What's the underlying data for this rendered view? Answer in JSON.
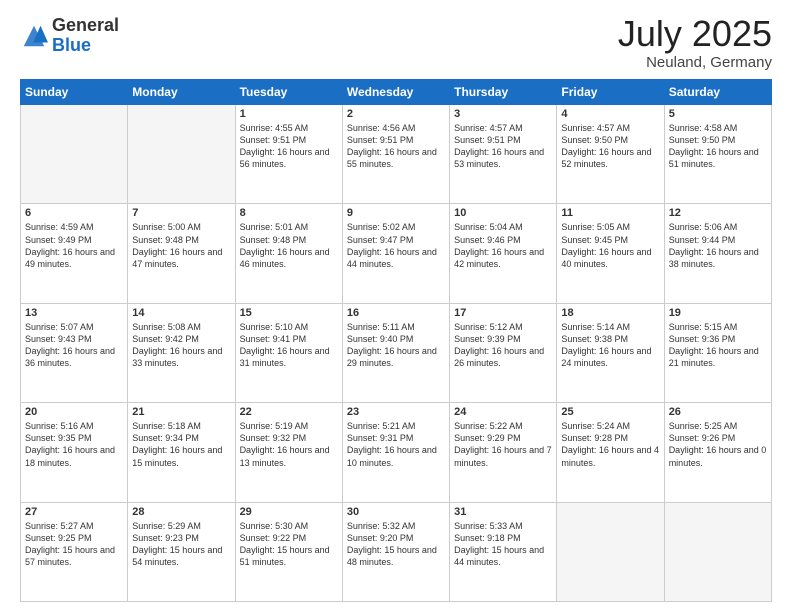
{
  "header": {
    "logo_general": "General",
    "logo_blue": "Blue",
    "month": "July 2025",
    "location": "Neuland, Germany"
  },
  "days_of_week": [
    "Sunday",
    "Monday",
    "Tuesday",
    "Wednesday",
    "Thursday",
    "Friday",
    "Saturday"
  ],
  "weeks": [
    [
      {
        "day": "",
        "empty": true
      },
      {
        "day": "",
        "empty": true
      },
      {
        "day": "1",
        "sunrise": "4:55 AM",
        "sunset": "9:51 PM",
        "daylight": "16 hours and 56 minutes."
      },
      {
        "day": "2",
        "sunrise": "4:56 AM",
        "sunset": "9:51 PM",
        "daylight": "16 hours and 55 minutes."
      },
      {
        "day": "3",
        "sunrise": "4:57 AM",
        "sunset": "9:51 PM",
        "daylight": "16 hours and 53 minutes."
      },
      {
        "day": "4",
        "sunrise": "4:57 AM",
        "sunset": "9:50 PM",
        "daylight": "16 hours and 52 minutes."
      },
      {
        "day": "5",
        "sunrise": "4:58 AM",
        "sunset": "9:50 PM",
        "daylight": "16 hours and 51 minutes."
      }
    ],
    [
      {
        "day": "6",
        "sunrise": "4:59 AM",
        "sunset": "9:49 PM",
        "daylight": "16 hours and 49 minutes."
      },
      {
        "day": "7",
        "sunrise": "5:00 AM",
        "sunset": "9:48 PM",
        "daylight": "16 hours and 47 minutes."
      },
      {
        "day": "8",
        "sunrise": "5:01 AM",
        "sunset": "9:48 PM",
        "daylight": "16 hours and 46 minutes."
      },
      {
        "day": "9",
        "sunrise": "5:02 AM",
        "sunset": "9:47 PM",
        "daylight": "16 hours and 44 minutes."
      },
      {
        "day": "10",
        "sunrise": "5:04 AM",
        "sunset": "9:46 PM",
        "daylight": "16 hours and 42 minutes."
      },
      {
        "day": "11",
        "sunrise": "5:05 AM",
        "sunset": "9:45 PM",
        "daylight": "16 hours and 40 minutes."
      },
      {
        "day": "12",
        "sunrise": "5:06 AM",
        "sunset": "9:44 PM",
        "daylight": "16 hours and 38 minutes."
      }
    ],
    [
      {
        "day": "13",
        "sunrise": "5:07 AM",
        "sunset": "9:43 PM",
        "daylight": "16 hours and 36 minutes."
      },
      {
        "day": "14",
        "sunrise": "5:08 AM",
        "sunset": "9:42 PM",
        "daylight": "16 hours and 33 minutes."
      },
      {
        "day": "15",
        "sunrise": "5:10 AM",
        "sunset": "9:41 PM",
        "daylight": "16 hours and 31 minutes."
      },
      {
        "day": "16",
        "sunrise": "5:11 AM",
        "sunset": "9:40 PM",
        "daylight": "16 hours and 29 minutes."
      },
      {
        "day": "17",
        "sunrise": "5:12 AM",
        "sunset": "9:39 PM",
        "daylight": "16 hours and 26 minutes."
      },
      {
        "day": "18",
        "sunrise": "5:14 AM",
        "sunset": "9:38 PM",
        "daylight": "16 hours and 24 minutes."
      },
      {
        "day": "19",
        "sunrise": "5:15 AM",
        "sunset": "9:36 PM",
        "daylight": "16 hours and 21 minutes."
      }
    ],
    [
      {
        "day": "20",
        "sunrise": "5:16 AM",
        "sunset": "9:35 PM",
        "daylight": "16 hours and 18 minutes."
      },
      {
        "day": "21",
        "sunrise": "5:18 AM",
        "sunset": "9:34 PM",
        "daylight": "16 hours and 15 minutes."
      },
      {
        "day": "22",
        "sunrise": "5:19 AM",
        "sunset": "9:32 PM",
        "daylight": "16 hours and 13 minutes."
      },
      {
        "day": "23",
        "sunrise": "5:21 AM",
        "sunset": "9:31 PM",
        "daylight": "16 hours and 10 minutes."
      },
      {
        "day": "24",
        "sunrise": "5:22 AM",
        "sunset": "9:29 PM",
        "daylight": "16 hours and 7 minutes."
      },
      {
        "day": "25",
        "sunrise": "5:24 AM",
        "sunset": "9:28 PM",
        "daylight": "16 hours and 4 minutes."
      },
      {
        "day": "26",
        "sunrise": "5:25 AM",
        "sunset": "9:26 PM",
        "daylight": "16 hours and 0 minutes."
      }
    ],
    [
      {
        "day": "27",
        "sunrise": "5:27 AM",
        "sunset": "9:25 PM",
        "daylight": "15 hours and 57 minutes."
      },
      {
        "day": "28",
        "sunrise": "5:29 AM",
        "sunset": "9:23 PM",
        "daylight": "15 hours and 54 minutes."
      },
      {
        "day": "29",
        "sunrise": "5:30 AM",
        "sunset": "9:22 PM",
        "daylight": "15 hours and 51 minutes."
      },
      {
        "day": "30",
        "sunrise": "5:32 AM",
        "sunset": "9:20 PM",
        "daylight": "15 hours and 48 minutes."
      },
      {
        "day": "31",
        "sunrise": "5:33 AM",
        "sunset": "9:18 PM",
        "daylight": "15 hours and 44 minutes."
      },
      {
        "day": "",
        "empty": true
      },
      {
        "day": "",
        "empty": true
      }
    ]
  ]
}
